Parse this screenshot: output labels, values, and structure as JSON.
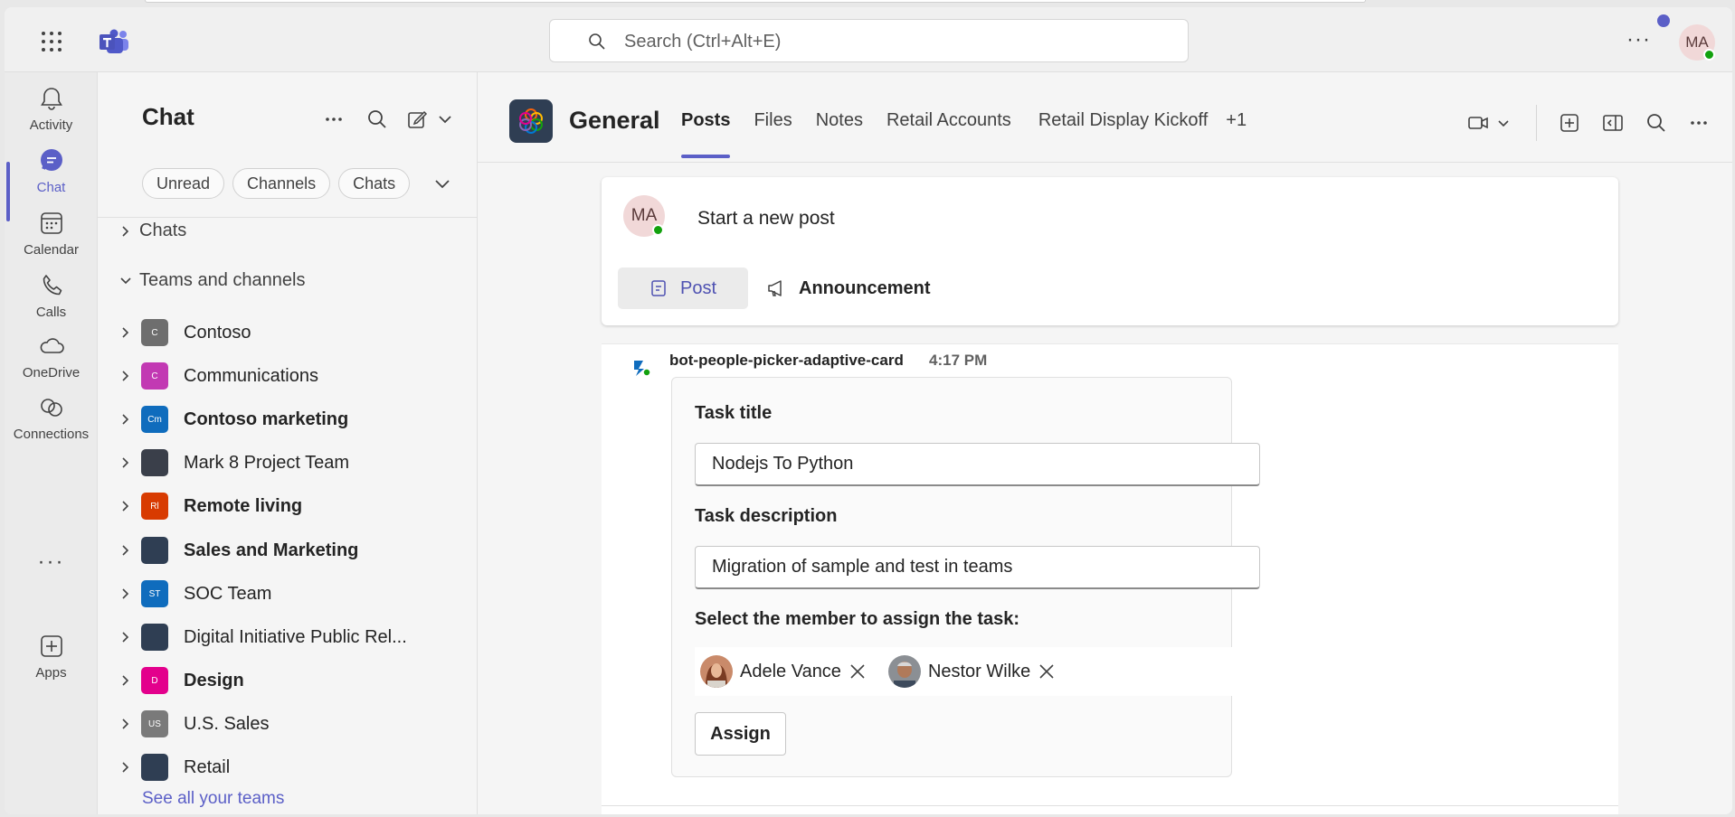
{
  "titlebar": {
    "search_placeholder": "Search (Ctrl+Alt+E)",
    "more": "···",
    "user_initials": "MA"
  },
  "rail": {
    "items": [
      {
        "label": "Activity",
        "icon": "bell-icon"
      },
      {
        "label": "Chat",
        "icon": "chat-icon",
        "active": true
      },
      {
        "label": "Calendar",
        "icon": "calendar-icon"
      },
      {
        "label": "Calls",
        "icon": "phone-icon"
      },
      {
        "label": "OneDrive",
        "icon": "cloud-icon"
      },
      {
        "label": "Connections",
        "icon": "connections-icon"
      },
      {
        "label": "Apps",
        "icon": "apps-icon"
      }
    ],
    "more": "···"
  },
  "chatpane": {
    "title": "Chat",
    "filters": [
      "Unread",
      "Channels",
      "Chats"
    ],
    "sections": {
      "chats": "Chats",
      "teams": "Teams and channels"
    },
    "teams": [
      {
        "name": "Contoso",
        "abbr": "C",
        "color": "#6e6e6e",
        "bold": false
      },
      {
        "name": "Communications",
        "abbr": "C",
        "color": "#c239b3",
        "bold": false
      },
      {
        "name": "Contoso marketing",
        "abbr": "Cm",
        "color": "#0f6cbd",
        "bold": true
      },
      {
        "name": "Mark 8 Project Team",
        "abbr": "",
        "color": "#3a3f4a",
        "bold": false
      },
      {
        "name": "Remote living",
        "abbr": "Rl",
        "color": "#d83b01",
        "bold": true
      },
      {
        "name": "Sales and Marketing",
        "abbr": "",
        "color": "#2f3e53",
        "bold": true
      },
      {
        "name": "SOC Team",
        "abbr": "ST",
        "color": "#0f6cbd",
        "bold": false
      },
      {
        "name": "Digital Initiative Public Rel...",
        "abbr": "",
        "color": "#2f3e53",
        "bold": false
      },
      {
        "name": "Design",
        "abbr": "D",
        "color": "#e3008c",
        "bold": true
      },
      {
        "name": "U.S. Sales",
        "abbr": "US",
        "color": "#7a7a7a",
        "bold": false
      },
      {
        "name": "Retail",
        "abbr": "",
        "color": "#2f3e53",
        "bold": false
      }
    ],
    "see_all": "See all your teams"
  },
  "channel": {
    "name": "General",
    "tabs": [
      "Posts",
      "Files",
      "Notes",
      "Retail Accounts",
      "Retail Display Kickoff",
      "+1"
    ],
    "active_tab": "Posts"
  },
  "newpost": {
    "initials": "MA",
    "prompt": "Start a new post",
    "post_label": "Post",
    "announcement_label": "Announcement"
  },
  "message": {
    "sender": "bot-people-picker-adaptive-card",
    "time": "4:17 PM",
    "card": {
      "title_label": "Task title",
      "title_value": "Nodejs To Python",
      "desc_label": "Task description",
      "desc_value": "Migration of sample and test in teams",
      "assign_label": "Select the member to assign the task:",
      "people": [
        "Adele Vance",
        "Nestor Wilke"
      ],
      "assign_button": "Assign"
    }
  },
  "colors": {
    "accent": "#5b5fc7",
    "presence": "#13a10e"
  }
}
